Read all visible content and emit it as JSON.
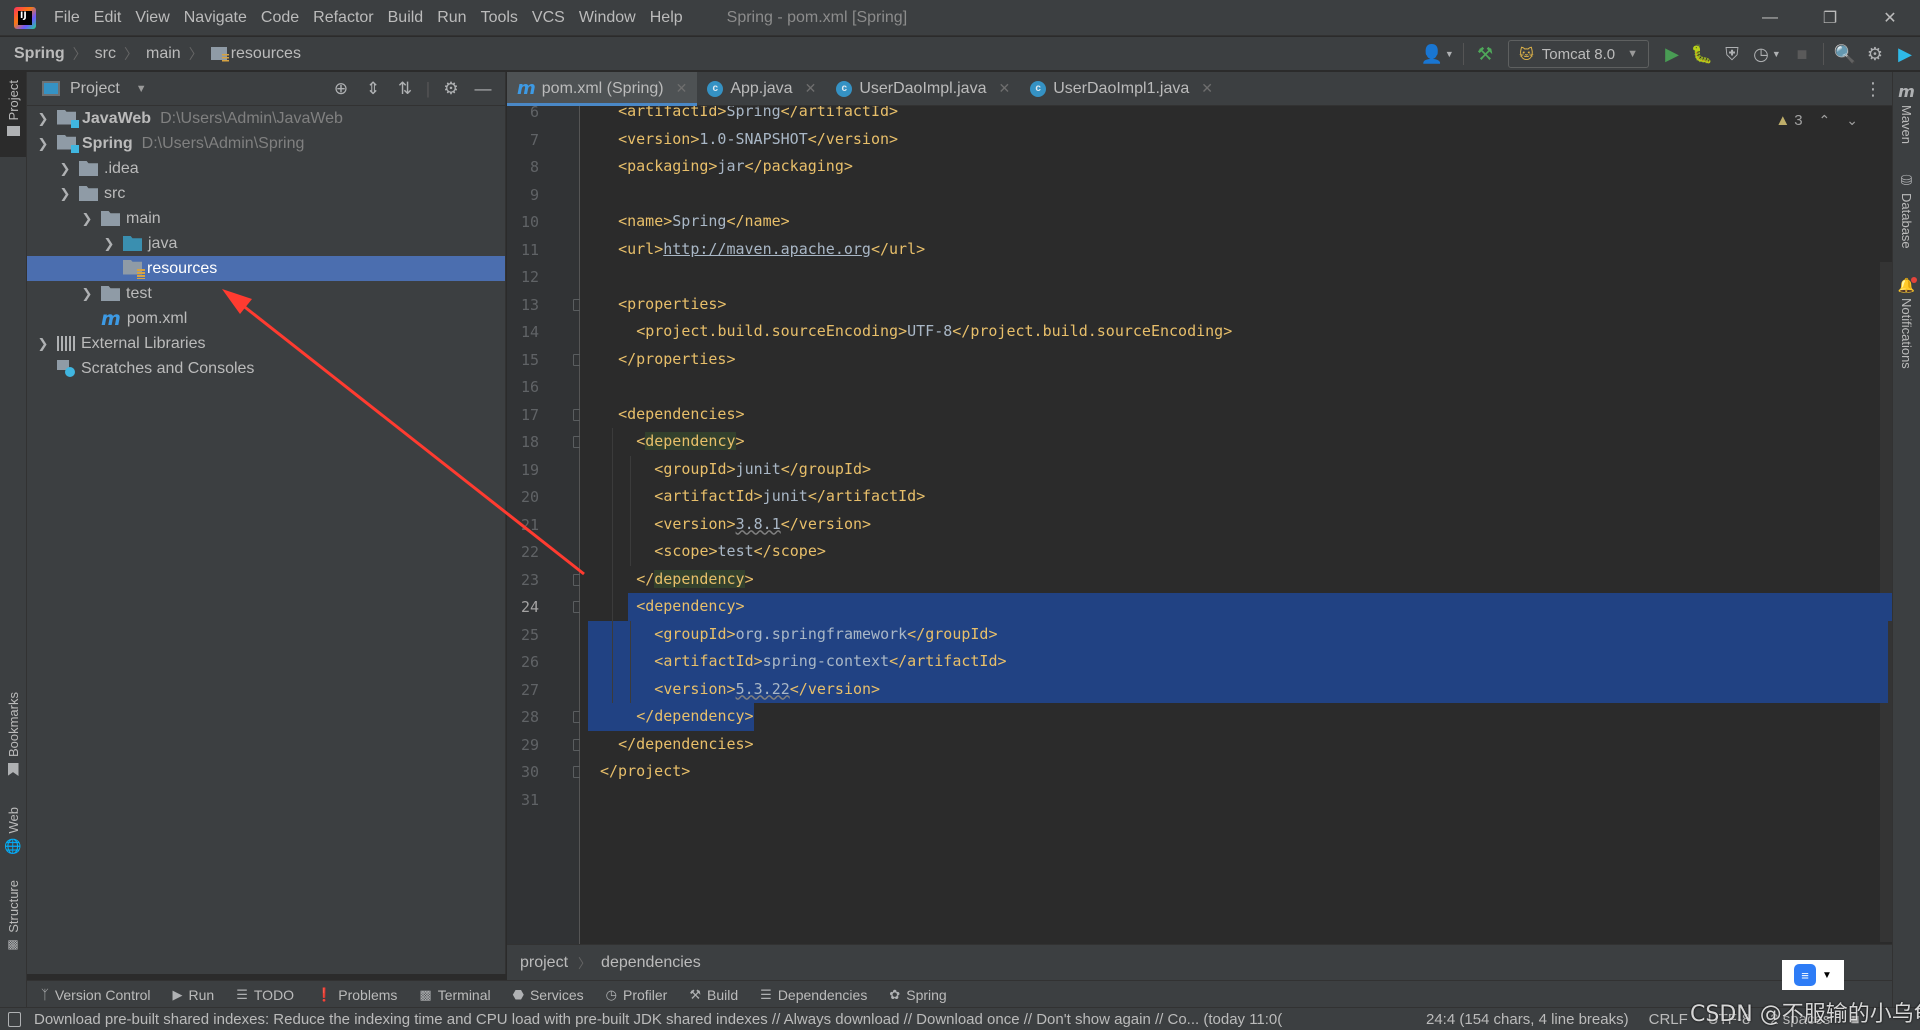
{
  "menubar": {
    "items": [
      "File",
      "Edit",
      "View",
      "Navigate",
      "Code",
      "Refactor",
      "Build",
      "Run",
      "Tools",
      "VCS",
      "Window",
      "Help"
    ],
    "window_title": "Spring - pom.xml [Spring]",
    "window_controls": [
      "minimize",
      "restore",
      "close"
    ]
  },
  "navbar": {
    "breadcrumbs": [
      "Spring",
      "src",
      "main",
      "resources"
    ],
    "run_config": "Tomcat 8.0"
  },
  "left_stripe": {
    "tabs": [
      "Project",
      "Bookmarks",
      "Web",
      "Structure"
    ]
  },
  "right_stripe": {
    "tabs": [
      "Maven",
      "Database",
      "Notifications"
    ]
  },
  "project_panel": {
    "title": "Project",
    "tree": [
      {
        "label": "JavaWeb",
        "path": "D:\\Users\\Admin\\JavaWeb",
        "depth": 0,
        "expanded": false,
        "type": "module"
      },
      {
        "label": "Spring",
        "path": "D:\\Users\\Admin\\Spring",
        "depth": 0,
        "expanded": true,
        "type": "module"
      },
      {
        "label": ".idea",
        "depth": 1,
        "expanded": false,
        "type": "folder"
      },
      {
        "label": "src",
        "depth": 1,
        "expanded": true,
        "type": "folder"
      },
      {
        "label": "main",
        "depth": 2,
        "expanded": true,
        "type": "folder"
      },
      {
        "label": "java",
        "depth": 3,
        "expanded": false,
        "type": "source-folder"
      },
      {
        "label": "resources",
        "depth": 3,
        "type": "resources-folder",
        "selected": true
      },
      {
        "label": "test",
        "depth": 2,
        "expanded": false,
        "type": "folder"
      },
      {
        "label": "pom.xml",
        "depth": 1,
        "type": "maven-file"
      },
      {
        "label": "External Libraries",
        "depth": 0,
        "expanded": false,
        "type": "libraries"
      },
      {
        "label": "Scratches and Consoles",
        "depth": 0,
        "type": "scratches"
      }
    ]
  },
  "editor": {
    "tabs": [
      {
        "label": "pom.xml (Spring)",
        "icon": "maven",
        "active": true
      },
      {
        "label": "App.java",
        "icon": "class-runnable"
      },
      {
        "label": "UserDaoImpl.java",
        "icon": "class"
      },
      {
        "label": "UserDaoImpl1.java",
        "icon": "class"
      }
    ],
    "inspection": {
      "warnings": "3"
    },
    "lines": [
      {
        "no": "6",
        "text": "<artifactId>Spring</artifactId>"
      },
      {
        "no": "7",
        "text": "<version>1.0-SNAPSHOT</version>"
      },
      {
        "no": "8",
        "text": "<packaging>jar</packaging>"
      },
      {
        "no": "9",
        "text": ""
      },
      {
        "no": "10",
        "text": "<name>Spring</name>"
      },
      {
        "no": "11",
        "text": "<url>http://maven.apache.org</url>"
      },
      {
        "no": "12",
        "text": ""
      },
      {
        "no": "13",
        "text": "<properties>"
      },
      {
        "no": "14",
        "text": "<project.build.sourceEncoding>UTF-8</project.build.sourceEncoding>"
      },
      {
        "no": "15",
        "text": "</properties>"
      },
      {
        "no": "16",
        "text": ""
      },
      {
        "no": "17",
        "text": "<dependencies>"
      },
      {
        "no": "18",
        "text": "<dependency>"
      },
      {
        "no": "19",
        "text": "<groupId>junit</groupId>"
      },
      {
        "no": "20",
        "text": "<artifactId>junit</artifactId>"
      },
      {
        "no": "21",
        "text": "<version>3.8.1</version>"
      },
      {
        "no": "22",
        "text": "<scope>test</scope>"
      },
      {
        "no": "23",
        "text": "</dependency>"
      },
      {
        "no": "24",
        "text": "<dependency>"
      },
      {
        "no": "25",
        "text": "<groupId>org.springframework</groupId>"
      },
      {
        "no": "26",
        "text": "<artifactId>spring-context</artifactId>"
      },
      {
        "no": "27",
        "text": "<version>5.3.22</version>"
      },
      {
        "no": "28",
        "text": "</dependency>"
      },
      {
        "no": "29",
        "text": "</dependencies>"
      },
      {
        "no": "30",
        "text": "</project>"
      },
      {
        "no": "31",
        "text": ""
      }
    ],
    "current_line": "24",
    "breadcrumbs": [
      "project",
      "dependencies"
    ]
  },
  "bottom_tools": [
    "Version Control",
    "Run",
    "TODO",
    "Problems",
    "Terminal",
    "Services",
    "Profiler",
    "Build",
    "Dependencies",
    "Spring"
  ],
  "statusbar": {
    "message": "Download pre-built shared indexes: Reduce the indexing time and CPU load with pre-built JDK shared indexes // Always download // Download once // Don't show again // Co... (today 11:0(",
    "caret": "24:4 (154 chars, 4 line breaks)",
    "line_separator": "CRLF",
    "encoding": "UTF-8",
    "indent": "2 spaces"
  },
  "overlay": {
    "watermark": "CSDN @不服输的小乌龟",
    "arrow_color": "#ff3b30"
  }
}
